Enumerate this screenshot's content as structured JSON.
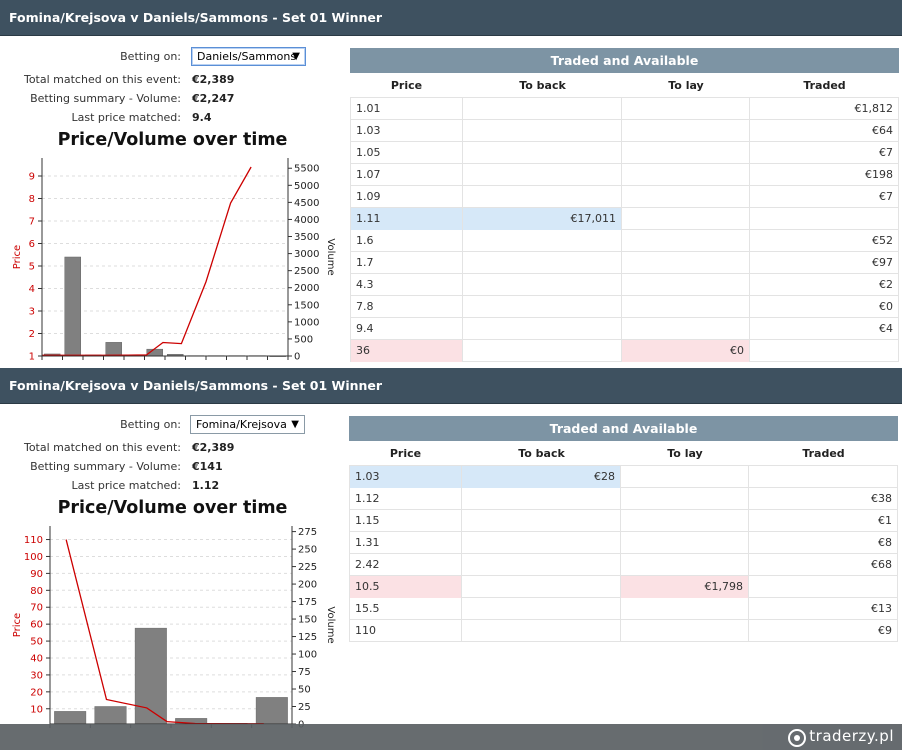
{
  "panels": [
    {
      "title": "Fomina/Krejsova v Daniels/Sammons - Set 01 Winner",
      "betting_on_label": "Betting on:",
      "betting_on_value": "Daniels/Sammons",
      "total_matched_label": "Total matched on this event:",
      "total_matched_value": "€2,389",
      "summary_volume_label": "Betting summary - Volume:",
      "summary_volume_value": "€2,247",
      "last_price_label": "Last price matched:",
      "last_price_value": "9.4",
      "table": {
        "header": "Traded and Available",
        "columns": [
          "Price",
          "To back",
          "To lay",
          "Traded"
        ],
        "rows": [
          {
            "price": "1.01",
            "back": "",
            "lay": "",
            "traded": "€1,812",
            "hl": ""
          },
          {
            "price": "1.03",
            "back": "",
            "lay": "",
            "traded": "€64",
            "hl": ""
          },
          {
            "price": "1.05",
            "back": "",
            "lay": "",
            "traded": "€7",
            "hl": ""
          },
          {
            "price": "1.07",
            "back": "",
            "lay": "",
            "traded": "€198",
            "hl": ""
          },
          {
            "price": "1.09",
            "back": "",
            "lay": "",
            "traded": "€7",
            "hl": ""
          },
          {
            "price": "1.11",
            "back": "€17,011",
            "lay": "",
            "traded": "",
            "hl": "back"
          },
          {
            "price": "1.6",
            "back": "",
            "lay": "",
            "traded": "€52",
            "hl": ""
          },
          {
            "price": "1.7",
            "back": "",
            "lay": "",
            "traded": "€97",
            "hl": ""
          },
          {
            "price": "4.3",
            "back": "",
            "lay": "",
            "traded": "€2",
            "hl": ""
          },
          {
            "price": "7.8",
            "back": "",
            "lay": "",
            "traded": "€0",
            "hl": ""
          },
          {
            "price": "9.4",
            "back": "",
            "lay": "",
            "traded": "€4",
            "hl": ""
          },
          {
            "price": "36",
            "back": "",
            "lay": "€0",
            "traded": "",
            "hl": "lay"
          }
        ]
      }
    },
    {
      "title": "Fomina/Krejsova v Daniels/Sammons - Set 01 Winner",
      "betting_on_label": "Betting on:",
      "betting_on_value": "Fomina/Krejsova",
      "total_matched_label": "Total matched on this event:",
      "total_matched_value": "€2,389",
      "summary_volume_label": "Betting summary - Volume:",
      "summary_volume_value": "€141",
      "last_price_label": "Last price matched:",
      "last_price_value": "1.12",
      "table": {
        "header": "Traded and Available",
        "columns": [
          "Price",
          "To back",
          "To lay",
          "Traded"
        ],
        "rows": [
          {
            "price": "1.03",
            "back": "€28",
            "lay": "",
            "traded": "",
            "hl": "back"
          },
          {
            "price": "1.12",
            "back": "",
            "lay": "",
            "traded": "€38",
            "hl": ""
          },
          {
            "price": "1.15",
            "back": "",
            "lay": "",
            "traded": "€1",
            "hl": ""
          },
          {
            "price": "1.31",
            "back": "",
            "lay": "",
            "traded": "€8",
            "hl": ""
          },
          {
            "price": "2.42",
            "back": "",
            "lay": "",
            "traded": "€68",
            "hl": ""
          },
          {
            "price": "10.5",
            "back": "",
            "lay": "€1,798",
            "traded": "",
            "hl": "lay"
          },
          {
            "price": "15.5",
            "back": "",
            "lay": "",
            "traded": "€13",
            "hl": ""
          },
          {
            "price": "110",
            "back": "",
            "lay": "",
            "traded": "€9",
            "hl": ""
          }
        ]
      }
    }
  ],
  "chart_data": [
    {
      "type": "bar",
      "title": "Price/Volume over time",
      "ylabel": "Price",
      "y2label": "Volume",
      "ylim": [
        1,
        9.8
      ],
      "yticks": [
        1,
        2,
        3,
        4,
        5,
        6,
        7,
        8,
        9
      ],
      "y2lim": [
        0,
        5800
      ],
      "y2ticks": [
        0,
        500,
        1000,
        1500,
        2000,
        2500,
        3000,
        3500,
        4000,
        4500,
        5000,
        5500
      ],
      "n_slots": 12,
      "series": [
        {
          "name": "Volume",
          "kind": "bar",
          "color": "#808080",
          "values": [
            60,
            2900,
            30,
            400,
            10,
            200,
            50,
            10,
            10,
            10,
            10,
            0
          ]
        },
        {
          "name": "Price",
          "kind": "line",
          "color": "#cc0000",
          "values": [
            1.03,
            1.03,
            1.03,
            1.04,
            1.05,
            1.6,
            1.55,
            4.3,
            7.8,
            9.4
          ]
        }
      ],
      "line_x_slots": [
        0,
        1.5,
        3,
        4.2,
        5.1,
        5.9,
        6.8,
        8.0,
        9.2,
        10.2
      ],
      "grid": true
    },
    {
      "type": "bar",
      "title": "Price/Volume over time",
      "ylabel": "Price",
      "y2label": "Volume",
      "ylim": [
        1,
        118
      ],
      "yticks": [
        10,
        20,
        30,
        40,
        50,
        60,
        70,
        80,
        90,
        100,
        110
      ],
      "y2lim": [
        0,
        283
      ],
      "y2ticks": [
        0,
        25,
        50,
        75,
        100,
        125,
        150,
        175,
        200,
        225,
        250,
        275
      ],
      "n_slots": 6,
      "series": [
        {
          "name": "Volume",
          "kind": "bar",
          "color": "#808080",
          "values": [
            18,
            25,
            137,
            8,
            1,
            38
          ]
        },
        {
          "name": "Price",
          "kind": "line",
          "color": "#cc0000",
          "values": [
            110,
            15.5,
            10.5,
            2.42,
            1.31,
            1.15,
            1.12
          ]
        }
      ],
      "line_x_slots": [
        0.4,
        1.4,
        2.4,
        2.9,
        3.6,
        4.6,
        5.3
      ],
      "grid": true
    }
  ],
  "footer": {
    "brand": "traderzy.pl"
  }
}
